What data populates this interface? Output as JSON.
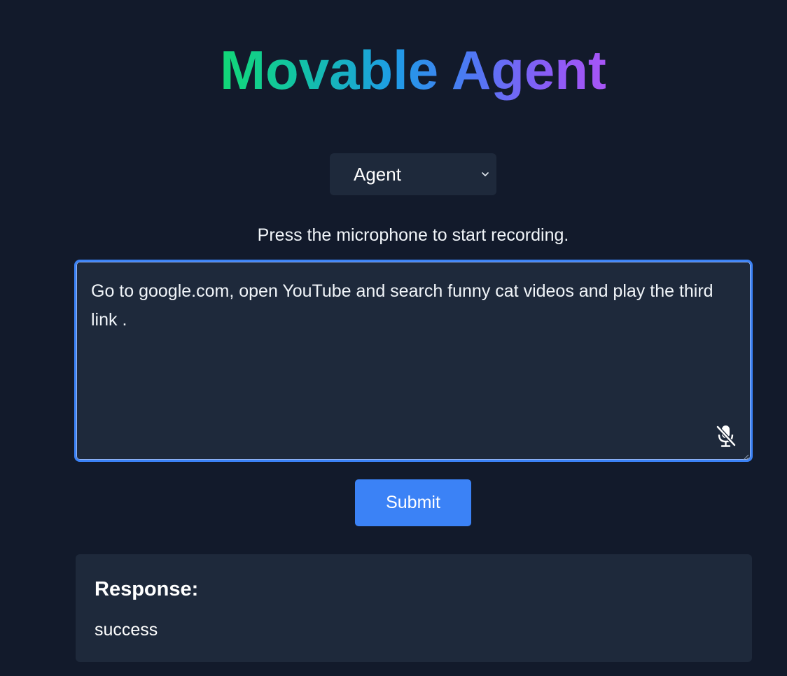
{
  "app": {
    "title": "Movable Agent"
  },
  "mode_select": {
    "selected": "Agent",
    "icon": "chevron-down-icon"
  },
  "hint": "Press the microphone to start recording.",
  "prompt": {
    "value": "Go to google.com, open YouTube and search funny cat videos and play the third link .",
    "mic_icon": "microphone-off-icon"
  },
  "submit_label": "Submit",
  "response": {
    "label": "Response:",
    "value": "success"
  },
  "colors": {
    "background": "#121a2b",
    "panel": "#1e293b",
    "accent": "#3b82f6",
    "title_gradient_start": "#12d876",
    "title_gradient_end": "#a855f7"
  }
}
